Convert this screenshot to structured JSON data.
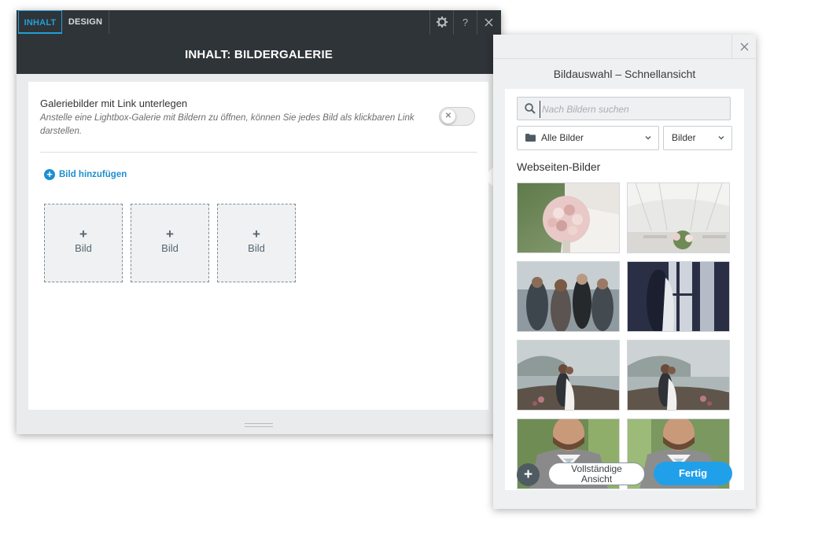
{
  "editor": {
    "tabs": [
      {
        "label": "INHALT",
        "active": true
      },
      {
        "label": "DESIGN",
        "active": false
      }
    ],
    "toolbar_icons": [
      "gear-icon",
      "help-icon",
      "close-icon"
    ],
    "help_glyph": "?",
    "header_title": "INHALT: BILDERGALERIE",
    "option": {
      "title": "Galeriebilder mit Link unterlegen",
      "description": "Anstelle eine Lightbox-Galerie mit Bildern zu öffnen, können Sie jedes Bild als klickbaren Link darstellen.",
      "toggle_on": false
    },
    "add_image_label": "Bild hinzufügen",
    "slots": [
      {
        "plus": "+",
        "label": "Bild"
      },
      {
        "plus": "+",
        "label": "Bild"
      },
      {
        "plus": "+",
        "label": "Bild"
      }
    ]
  },
  "picker": {
    "title": "Bildauswahl – Schnellansicht",
    "search_placeholder": "Nach Bildern suchen",
    "folder_select": "Alle Bilder",
    "type_select": "Bilder",
    "section_title": "Webseiten-Bilder",
    "thumbnails": [
      {
        "subject": "bridal-bouquet"
      },
      {
        "subject": "wedding-tent-tables"
      },
      {
        "subject": "crowd-dancing"
      },
      {
        "subject": "couple-window-silhouette"
      },
      {
        "subject": "couple-lakeside-1"
      },
      {
        "subject": "couple-lakeside-2"
      },
      {
        "subject": "groom-portrait-1"
      },
      {
        "subject": "groom-portrait-2"
      }
    ],
    "footer": {
      "add_glyph": "+",
      "full_view_line1": "Vollständige",
      "full_view_line2": "Ansicht",
      "done_label": "Fertig"
    }
  },
  "colors": {
    "accent": "#21a0ea",
    "dark_header": "#2f3438"
  }
}
